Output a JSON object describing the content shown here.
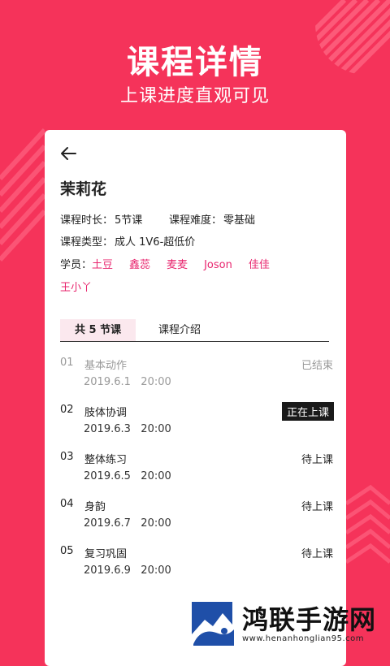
{
  "hero": {
    "title": "课程详情",
    "subtitle": "上课进度直观可见"
  },
  "course": {
    "name": "茉莉花",
    "duration_label": "课程时长：",
    "duration_value": "5节课",
    "difficulty_label": "课程难度：",
    "difficulty_value": "零基础",
    "type_label": "课程类型：",
    "type_value": "成人 1V6-超低价",
    "students_label": "学员：",
    "students": [
      "土豆",
      "鑫蕊",
      "麦麦",
      "Joson",
      "佳佳",
      "王小丫"
    ]
  },
  "tabs": [
    {
      "label": "共 5 节课",
      "active": true
    },
    {
      "label": "课程介绍",
      "active": false
    }
  ],
  "lessons": [
    {
      "num": "01",
      "name": "基本动作",
      "date": "2019.6.1",
      "time": "20:00",
      "status": "已结束"
    },
    {
      "num": "02",
      "name": "肢体协调",
      "date": "2019.6.3",
      "time": "20:00",
      "status": "正在上课"
    },
    {
      "num": "03",
      "name": "整体练习",
      "date": "2019.6.5",
      "time": "20:00",
      "status": "待上课"
    },
    {
      "num": "04",
      "name": "身韵",
      "date": "2019.6.7",
      "time": "20:00",
      "status": "待上课"
    },
    {
      "num": "05",
      "name": "复习巩固",
      "date": "2019.6.9",
      "time": "20:00",
      "status": "待上课"
    }
  ],
  "watermark": {
    "text": "鸿联手游网",
    "url": "www.henanhonglian95.com"
  },
  "colors": {
    "brand": "#f5335a",
    "student": "#e8256e",
    "tab_active_bg": "#fbe8ee",
    "live_badge": "#1a1a1a"
  }
}
